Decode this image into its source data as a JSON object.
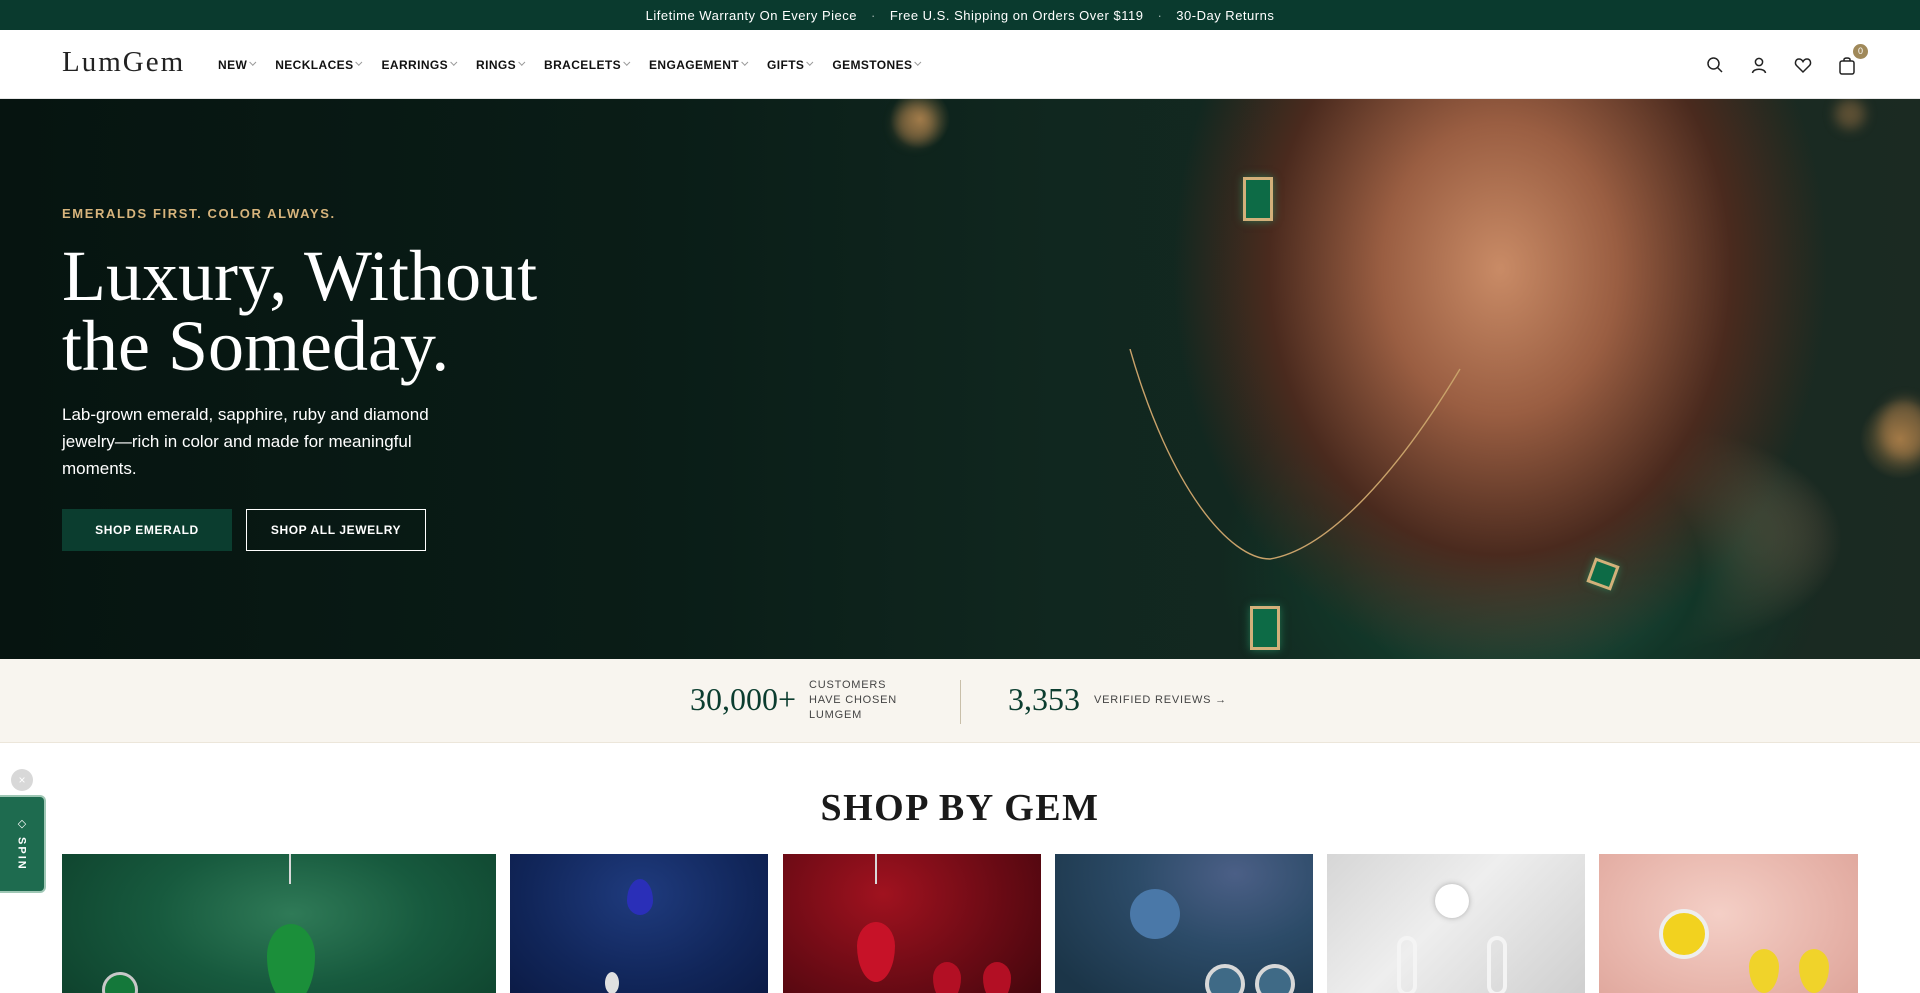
{
  "announcement": {
    "items": [
      "Lifetime Warranty On Every Piece",
      "Free U.S. Shipping on Orders Over $119",
      "30-Day Returns"
    ],
    "separator": "·"
  },
  "header": {
    "logo": "LumGem",
    "nav": [
      {
        "label": "NEW",
        "icon": "chevron-down-icon"
      },
      {
        "label": "NECKLACES",
        "icon": "chevron-down-icon"
      },
      {
        "label": "EARRINGS",
        "icon": "chevron-down-icon"
      },
      {
        "label": "RINGS",
        "icon": "chevron-down-icon"
      },
      {
        "label": "BRACELETS",
        "icon": "chevron-down-icon"
      },
      {
        "label": "ENGAGEMENT",
        "icon": "chevron-down-icon"
      },
      {
        "label": "GIFTS",
        "icon": "chevron-down-icon"
      },
      {
        "label": "GEMSTONES",
        "icon": "chevron-down-icon"
      }
    ],
    "icons": [
      "search-icon",
      "account-icon",
      "wishlist-heart-icon",
      "cart-bag-icon"
    ],
    "cart_count": "0"
  },
  "hero": {
    "eyebrow": "EMERALDS FIRST. COLOR ALWAYS.",
    "title_line1": "Luxury, Without",
    "title_line2": "the Someday.",
    "subtitle": "Lab-grown emerald, sapphire, ruby and diamond jewelry—rich in color and made for meaningful moments.",
    "primary_cta": "SHOP EMERALD",
    "secondary_cta": "SHOP ALL JEWELRY"
  },
  "stats": {
    "customers_number": "30,000+",
    "customers_label": "CUSTOMERS HAVE CHOSEN LUMGEM",
    "reviews_number": "3,353",
    "reviews_label": "VERIFIED REVIEWS →"
  },
  "shop_by_gem": {
    "title": "SHOP BY GEM",
    "tiles": [
      "emerald",
      "sapphire",
      "ruby",
      "blue-topaz",
      "diamond",
      "yellow-sapphire"
    ]
  },
  "spin_widget": {
    "label": "◇ SPIN",
    "close": "×"
  },
  "colors": {
    "brand_green": "#0b3d2f",
    "announcement_bg": "#0a3a2e",
    "accent_gold": "#d7b47c",
    "stats_bg": "#f8f5ef"
  }
}
